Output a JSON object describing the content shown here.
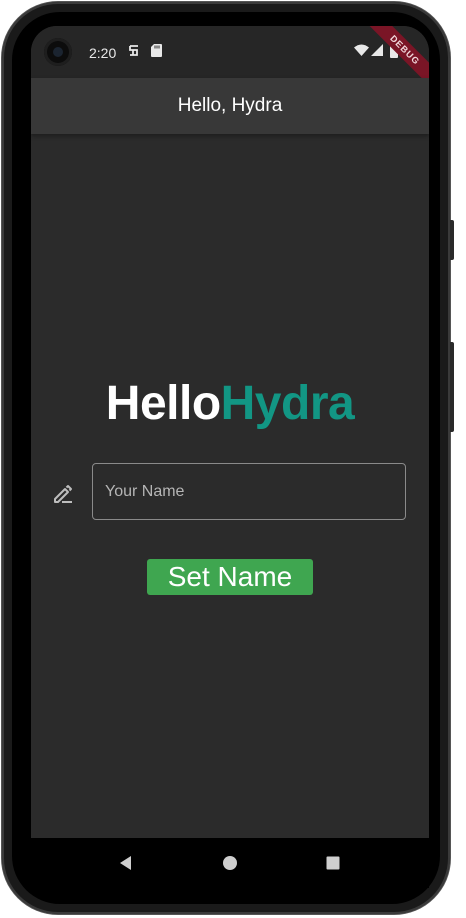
{
  "status_bar": {
    "time": "2:20",
    "icons": [
      "notification-s-icon",
      "sd-card-icon",
      "wifi-icon",
      "cellular-signal-icon",
      "battery-icon"
    ],
    "debug_label": "DEBUG"
  },
  "app_bar": {
    "title": "Hello, Hydra"
  },
  "brand": {
    "part1": "Hello",
    "part2": "Hydra",
    "colors": {
      "part1": "#ffffff",
      "part2": "#129684"
    }
  },
  "name_input": {
    "placeholder": "Your Name",
    "value": "",
    "icon": "edit-pencil-icon"
  },
  "set_button": {
    "label": "Set Name",
    "color": "#3fa650"
  },
  "nav_bar": {
    "buttons": [
      "back-icon",
      "home-icon",
      "recents-icon"
    ]
  },
  "theme": {
    "background": "#2b2b2b",
    "app_bar": "#383838"
  }
}
